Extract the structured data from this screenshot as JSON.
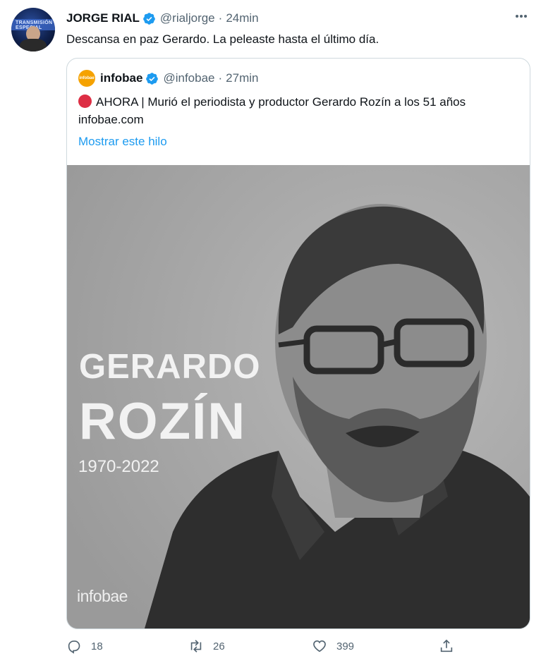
{
  "tweet": {
    "author_name": "JORGE RIAL",
    "handle": "@rialjorge",
    "separator": "·",
    "time": "24min",
    "text": "Descansa en paz Gerardo. La peleaste hasta el último día.",
    "avatar_text": "TRANSMISIÓN ESPECIAL"
  },
  "quote": {
    "logo_text": "infobae",
    "author_name": "infobae",
    "handle": "@infobae",
    "separator": "·",
    "time": "27min",
    "text": "AHORA | Murió el periodista y productor Gerardo Rozín a los 51 años infobae.com",
    "thread_link": "Mostrar este hilo",
    "media": {
      "first_name": "GERARDO",
      "last_name": "ROZÍN",
      "years": "1970-2022",
      "brand": "infobae"
    }
  },
  "actions": {
    "replies": "18",
    "retweets": "26",
    "likes": "399"
  },
  "colors": {
    "accent": "#1d9bf0",
    "muted": "#536471",
    "breaking_dot": "#dd2e44",
    "infobae_orange": "#f5a200"
  },
  "icons": [
    "verified-badge-icon",
    "more-options-icon",
    "reply-icon",
    "retweet-icon",
    "like-icon",
    "share-icon"
  ]
}
